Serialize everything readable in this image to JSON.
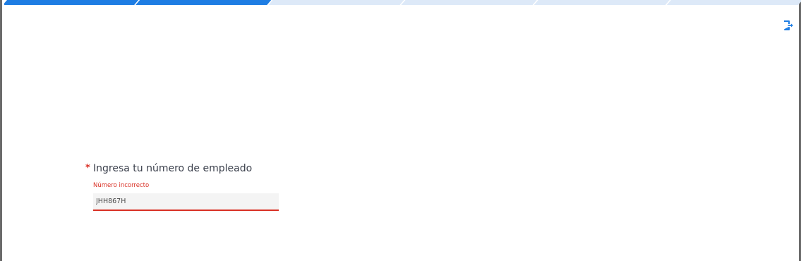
{
  "progress": {
    "completed_steps": 2,
    "total_steps": 6,
    "active_color": "#1e7de3",
    "inactive_color": "#dde9f8"
  },
  "header": {
    "logout_icon": "logout-icon"
  },
  "form": {
    "required_marker": "*",
    "label": "Ingresa tu número de empleado",
    "error": "Número incorrecto",
    "employee_number_value": "JHH867H"
  },
  "colors": {
    "accent": "#1e7de3",
    "error": "#d93025",
    "label_text": "#3a3f4b",
    "input_background": "#f4f4f4"
  }
}
